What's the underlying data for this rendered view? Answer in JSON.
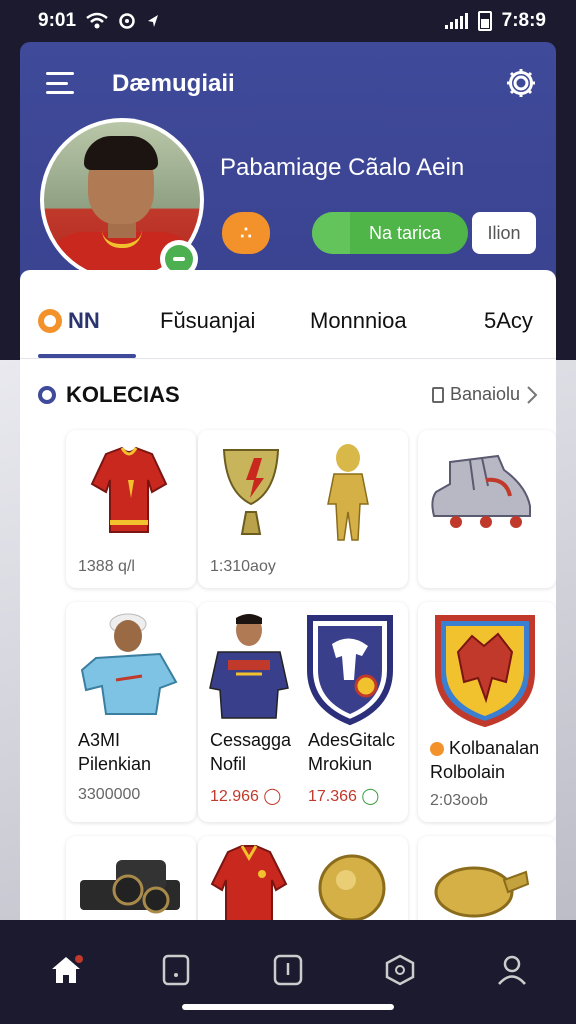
{
  "status_bar": {
    "time": "9:01",
    "clock_right": "7:8:9"
  },
  "header": {
    "title": "Dæmugiaii",
    "settings_icon": "gear-icon",
    "menu_icon": "menu-icon"
  },
  "profile": {
    "name": "Pabamiage Cãalo Aein",
    "orange_chip_label": "∴",
    "pill_label": "Na tarica",
    "join_label": "Ilion",
    "online": true
  },
  "tabs": [
    {
      "label": "NN",
      "active": true
    },
    {
      "label": "Fŭsuanjai",
      "active": false
    },
    {
      "label": "Monnnioa",
      "active": false
    },
    {
      "label": "5Acy",
      "active": false
    }
  ],
  "section": {
    "title": "KOLECIAS",
    "see_all": "Banaiolu"
  },
  "items": [
    {
      "sub": "1388 q/l",
      "icon": "jersey-icon"
    },
    {
      "sub": "1:310aoy",
      "icon": "trophy-icon"
    },
    {
      "sub": "",
      "icon": "boot-icon"
    },
    {
      "title1": "A3MI",
      "title2": "Pilenkian",
      "sub": "3300000",
      "icon": "player-icon"
    },
    {
      "title1": "Cessagga",
      "title2": "Nofil",
      "price": "12.966",
      "price_color": "#c0392b",
      "icon": "player-icon"
    },
    {
      "title1": "AdesGitalc",
      "title2": "Mrokiun",
      "price": "17.366",
      "price_color": "#3c9e3c",
      "icon": "crest-icon"
    },
    {
      "title1": "Kolbanalan",
      "title2": "Rolbolain",
      "sub": "2:03oob",
      "icon": "crest-icon"
    },
    {
      "icon": "camera-icon"
    },
    {
      "icon": "jacket-icon"
    },
    {
      "icon": "medal-icon"
    }
  ],
  "bottom_nav": [
    {
      "icon": "home-icon",
      "active": true
    },
    {
      "icon": "card-icon"
    },
    {
      "icon": "tag-icon"
    },
    {
      "icon": "badge-icon"
    },
    {
      "icon": "profile-icon"
    }
  ],
  "colors": {
    "header": "#3f4a9a",
    "accent_green": "#4fb548",
    "accent_orange": "#f3922a",
    "nav_bg": "#1c1a2e"
  }
}
